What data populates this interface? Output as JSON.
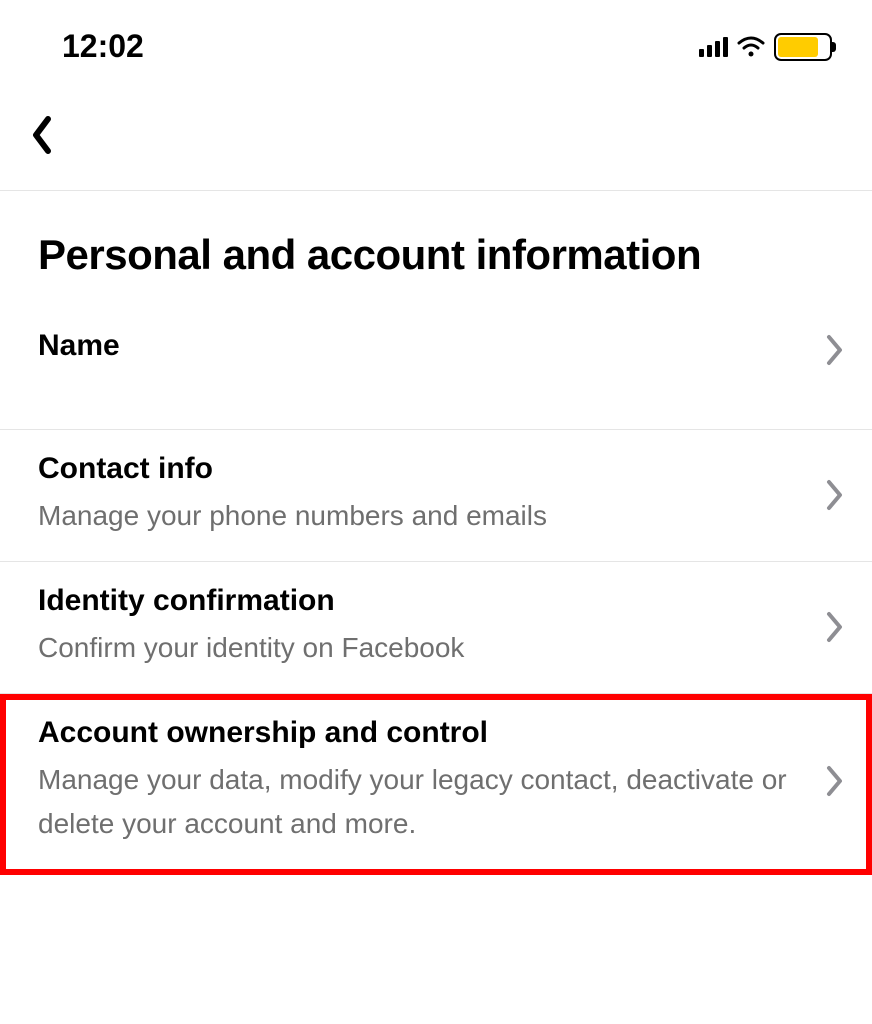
{
  "statusBar": {
    "time": "12:02"
  },
  "header": {
    "title": "Personal and account information"
  },
  "items": [
    {
      "title": "Name",
      "subtitle": ""
    },
    {
      "title": "Contact info",
      "subtitle": "Manage your phone numbers and emails"
    },
    {
      "title": "Identity confirmation",
      "subtitle": "Confirm your identity on Facebook"
    },
    {
      "title": "Account ownership and control",
      "subtitle": "Manage your data, modify your legacy contact, deactivate or delete your account and more."
    }
  ]
}
